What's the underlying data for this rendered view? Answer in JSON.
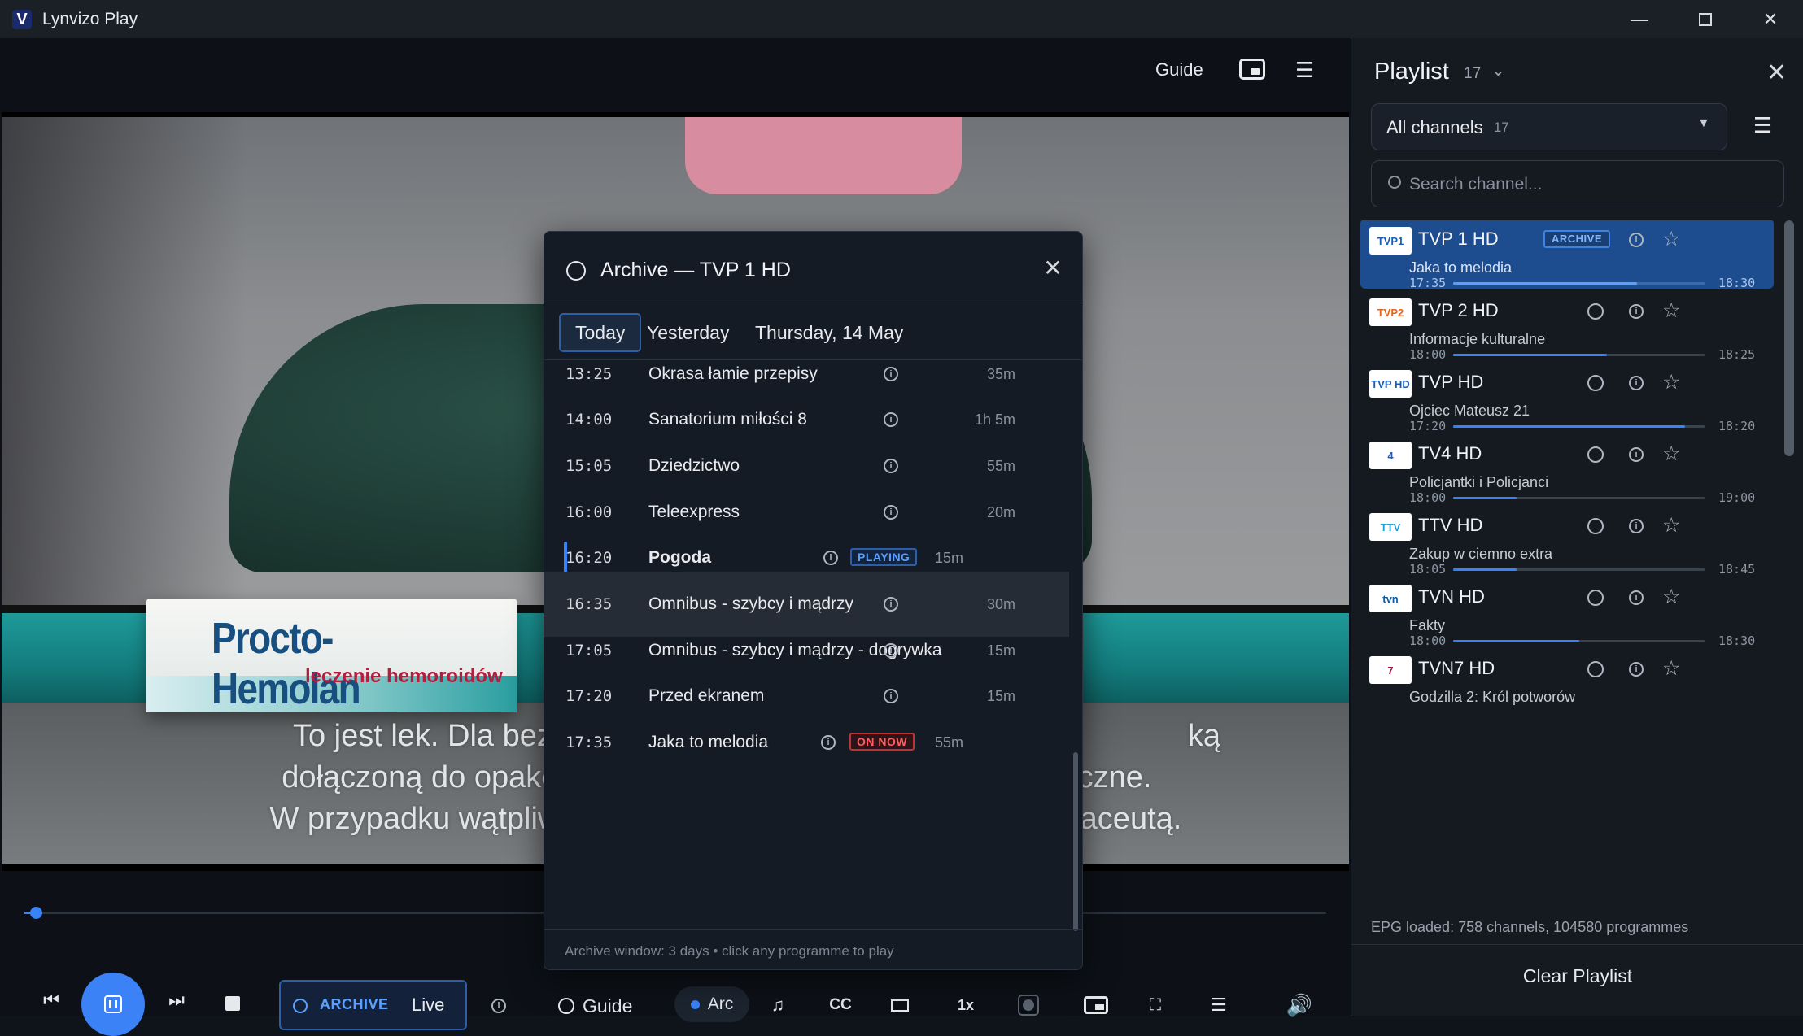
{
  "app": {
    "logo": "V",
    "title": "Lynvizo Play",
    "window_controls": [
      "minimize-icon",
      "maximize-icon",
      "close-icon"
    ]
  },
  "player": {
    "top_bar": {
      "guide_label": "Guide",
      "pip_icon": "picture-in-picture-icon",
      "menu_icon": "menu-icon"
    },
    "video": {
      "product_brand": "Procto-Hemolan",
      "product_sub": "leczenie hemoroidów",
      "subtitle_lines": [
        "To jest lek. Dla bezp",
        "ką",
        "dołączoną do opakow",
        "czne.",
        "W przypadku wątpliwoś",
        "aceutą."
      ]
    },
    "seek_progress": 0.005,
    "controls": {
      "archive_label": "ARCHIVE",
      "live_label": "Live",
      "guide_label": "Guide",
      "arc_label": "Arc",
      "speed_label": "1x",
      "cc_label": "CC",
      "icons": [
        "skip-back-icon",
        "pause-icon",
        "skip-forward-icon",
        "stop-icon",
        "info-icon",
        "music-note-icon",
        "aspect-ratio-icon",
        "record-icon",
        "picture-in-picture-icon",
        "fullscreen-icon",
        "menu-icon",
        "volume-icon"
      ]
    }
  },
  "archive_modal": {
    "title": "Archive — TVP 1 HD",
    "tabs": [
      "Today",
      "Yesterday",
      "Thursday, 14 May"
    ],
    "active_tab": "Today",
    "programmes": [
      {
        "time": "13:25",
        "title": "Okrasa łamie przepisy",
        "duration": "35m"
      },
      {
        "time": "14:00",
        "title": "Sanatorium miłości 8",
        "duration": "1h 5m"
      },
      {
        "time": "15:05",
        "title": "Dziedzictwo",
        "duration": "55m"
      },
      {
        "time": "16:00",
        "title": "Teleexpress",
        "duration": "20m"
      },
      {
        "time": "16:20",
        "title": "Pogoda",
        "duration": "15m",
        "badge": "PLAYING"
      },
      {
        "time": "16:35",
        "title": "Omnibus - szybcy i mądrzy",
        "duration": "30m"
      },
      {
        "time": "17:05",
        "title": "Omnibus - szybcy i mądrzy - dogrywka",
        "duration": "15m"
      },
      {
        "time": "17:20",
        "title": "Przed ekranem",
        "duration": "15m"
      },
      {
        "time": "17:35",
        "title": "Jaka to melodia",
        "duration": "55m",
        "badge": "ON NOW"
      }
    ],
    "footer": "Archive window: 3 days  •  click any programme to play"
  },
  "playlist": {
    "title": "Playlist",
    "count": "17",
    "filter": {
      "label": "All channels",
      "separator": "·",
      "count": "17"
    },
    "search_placeholder": "Search channel...",
    "channels": [
      {
        "name": "TVP 1 HD",
        "logo": "TVP1",
        "logo_color": "#1b5fb3",
        "programme": "Jaka to melodia",
        "start": "17:35",
        "end": "18:30",
        "progress": 0.73,
        "badge": "ARCHIVE",
        "active": true
      },
      {
        "name": "TVP 2 HD",
        "logo": "TVP2",
        "logo_color": "#e8641b",
        "programme": "Informacje kulturalne",
        "start": "18:00",
        "end": "18:25",
        "progress": 0.61
      },
      {
        "name": "TVP HD",
        "logo": "TVP HD",
        "logo_color": "#1b5fb3",
        "programme": "Ojciec Mateusz 21",
        "start": "17:20",
        "end": "18:20",
        "progress": 0.92
      },
      {
        "name": "TV4 HD",
        "logo": "4",
        "logo_color": "#2a5aa8",
        "programme": "Policjantki i Policjanci",
        "start": "18:00",
        "end": "19:00",
        "progress": 0.25
      },
      {
        "name": "TTV HD",
        "logo": "TTV",
        "logo_color": "#1ea0d8",
        "programme": "Zakup w ciemno extra",
        "start": "18:05",
        "end": "18:45",
        "progress": 0.25
      },
      {
        "name": "TVN HD",
        "logo": "tvn",
        "logo_color": "#0d5fa8",
        "programme": "Fakty",
        "start": "18:00",
        "end": "18:30",
        "progress": 0.5
      },
      {
        "name": "TVN7 HD",
        "logo": "7",
        "logo_color": "#a0184a",
        "programme": "Godzilla 2: Król potworów",
        "start": "",
        "end": "",
        "progress": 0
      }
    ],
    "epg_status": "EPG loaded: 758 channels, 104580 programmes",
    "clear_label": "Clear Playlist"
  }
}
